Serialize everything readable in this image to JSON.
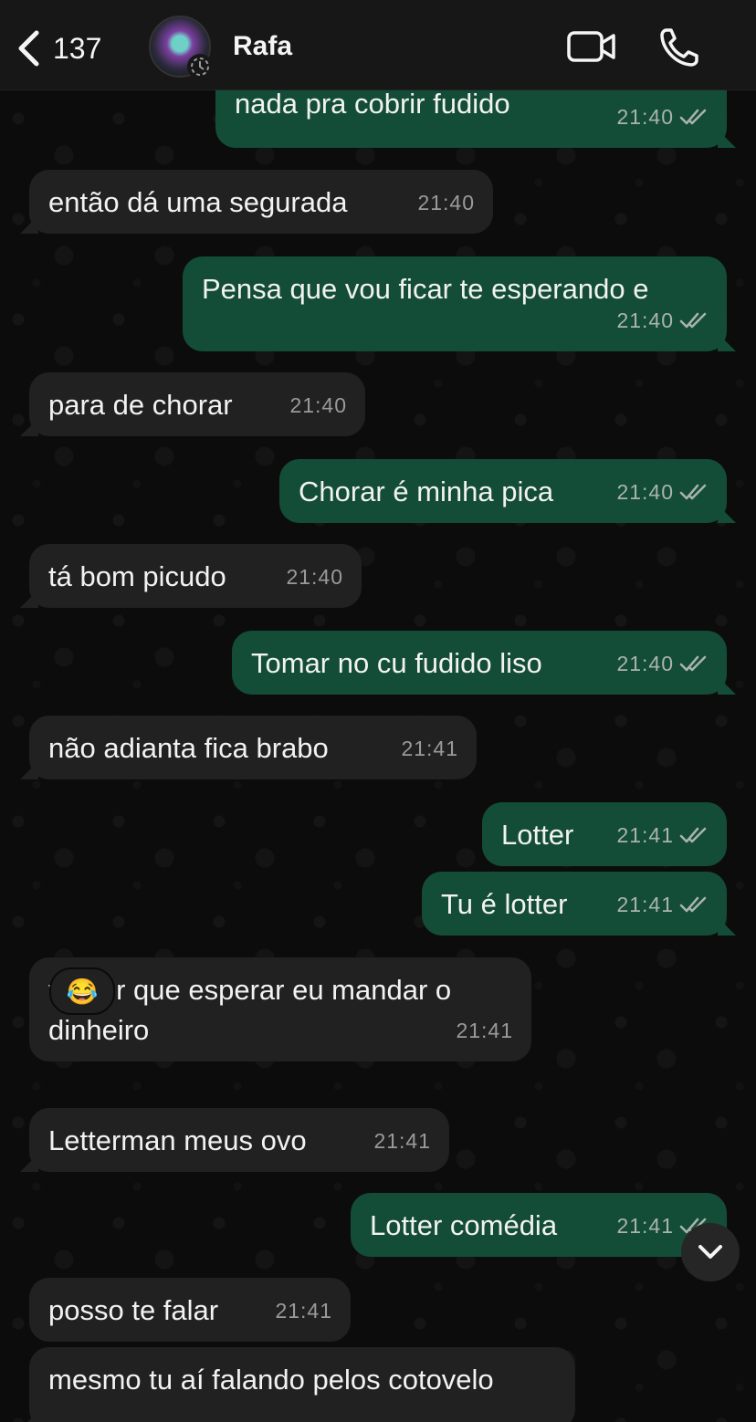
{
  "header": {
    "back_count": "137",
    "contact_name": "Rafa",
    "icons": [
      "chevron-left-icon",
      "video-camera-icon",
      "phone-icon"
    ]
  },
  "messages": [
    {
      "dir": "out",
      "text": "nada pra cobrir fudido",
      "time": "21:40",
      "status": "read"
    },
    {
      "dir": "in",
      "text": "então dá uma segurada",
      "time": "21:40"
    },
    {
      "dir": "out",
      "text": "Pensa que vou ficar te esperando e",
      "time": "21:40",
      "status": "read"
    },
    {
      "dir": "in",
      "text": "para de chorar",
      "time": "21:40"
    },
    {
      "dir": "out",
      "text": "Chorar é minha pica",
      "time": "21:40",
      "status": "read"
    },
    {
      "dir": "in",
      "text": "tá bom picudo",
      "time": "21:40"
    },
    {
      "dir": "out",
      "text": "Tomar no cu fudido liso",
      "time": "21:40",
      "status": "read"
    },
    {
      "dir": "in",
      "text": "não adianta fica brabo",
      "time": "21:41"
    },
    {
      "dir": "out",
      "text": "Lotter",
      "time": "21:41",
      "status": "read"
    },
    {
      "dir": "out",
      "text": "Tu é lotter",
      "time": "21:41",
      "status": "read"
    },
    {
      "dir": "in",
      "text": "vai ter que esperar eu mandar o\ndinheiro",
      "time": "21:41",
      "reaction": "😂"
    },
    {
      "dir": "in",
      "text": "Letterman meus ovo",
      "time": "21:41"
    },
    {
      "dir": "out",
      "text": "Lotter comédia",
      "time": "21:41",
      "status": "read"
    },
    {
      "dir": "in",
      "text": "posso te falar",
      "time": "21:41"
    },
    {
      "dir": "in",
      "text": "mesmo tu aí falando pelos cotovelo",
      "time": ""
    }
  ],
  "colors": {
    "incoming_bubble": "#212121",
    "outgoing_bubble": "#134d37",
    "read_ticks": "#a9b3ad",
    "header_bg": "#171717"
  }
}
